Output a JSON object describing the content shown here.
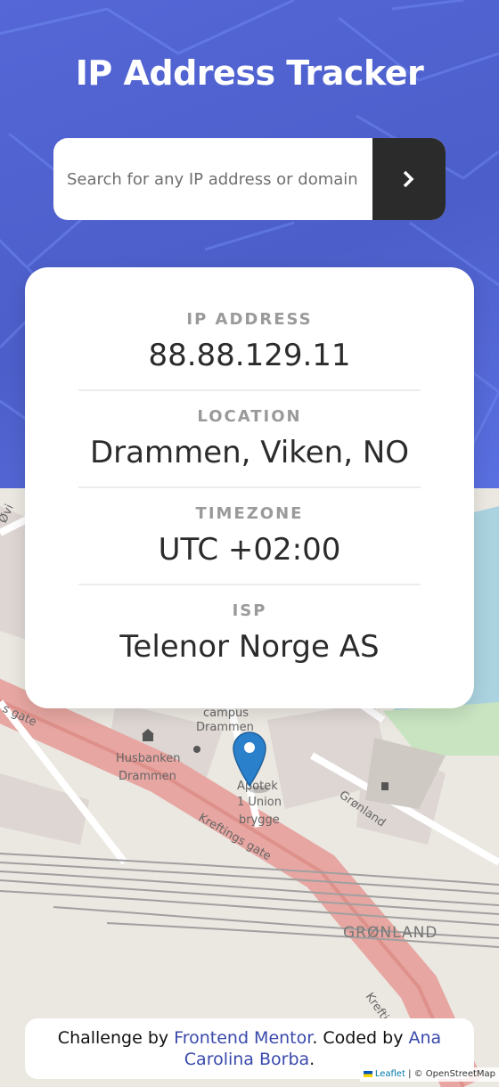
{
  "header": {
    "title": "IP Address Tracker",
    "search_placeholder": "Search for any IP address or domain",
    "accent_color": "#4c5ec9",
    "button_color": "#2b2b2b"
  },
  "info": {
    "ip_label": "IP ADDRESS",
    "ip_value": "88.88.129.11",
    "location_label": "LOCATION",
    "location_value": "Drammen, Viken, NO",
    "timezone_label": "TIMEZONE",
    "timezone_value": "UTC +02:00",
    "isp_label": "ISP",
    "isp_value": "Telenor Norge AS"
  },
  "map": {
    "labels": {
      "campus": "campus",
      "drammen": "Drammen",
      "husbanken": "Husbanken",
      "husbanken_city": "Drammen",
      "apotek": "Apotek",
      "union": "1 Union",
      "brygge": "brygge",
      "gronland_street": "Grønland",
      "kreftings1": "Kreftings gate",
      "kreftings2": "Kreftings gate",
      "gronland_area": "GRØNLAND",
      "s_gate": "s gate",
      "ovre": "Øvi"
    },
    "pin_icon": "map-marker-icon"
  },
  "footer": {
    "challenge_prefix": "Challenge by ",
    "frontend_mentor": "Frontend Mentor",
    "coded_by": ". Coded by ",
    "author": "Ana Carolina Borba",
    "end": "."
  },
  "map_attribution": {
    "leaflet": "Leaflet",
    "separator": " | © OpenStreetMap"
  }
}
